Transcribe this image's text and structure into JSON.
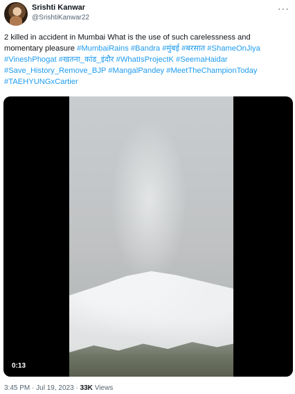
{
  "author": {
    "display_name": "Srishti Kanwar",
    "handle": "@SrishtiKanwar22"
  },
  "tweet": {
    "text": "2 killed in accident in Mumbai What is the use of such carelessness and momentary pleasure",
    "hashtags": [
      "#MumbaiRains",
      "#Bandra",
      "#मुंबई",
      "#बरसात",
      "#ShameOnJiya",
      "#VineshPhogat",
      "#खतना_कांड_इंदौर",
      "#WhatIsProjectK",
      "#SeemaHaidar",
      "#Save_History_Remove_BJP",
      "#MangalPandey",
      "#MeetTheChampionToday",
      "#TAEHYUNGxCartier"
    ]
  },
  "video": {
    "duration": "0:13"
  },
  "meta": {
    "time": "3:45 PM",
    "separator": "·",
    "date": "Jul 19, 2023",
    "views_count": "33K",
    "views_label": "Views"
  },
  "icons": {
    "more": "more-dots-icon"
  }
}
